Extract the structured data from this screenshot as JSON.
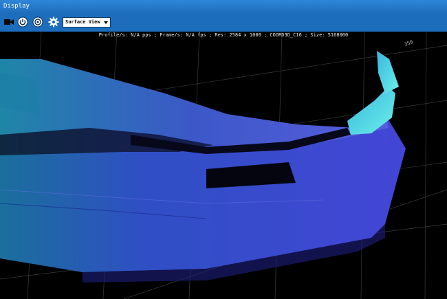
{
  "window": {
    "title": "Display"
  },
  "toolbar": {
    "view_mode": {
      "selected": "Surface View"
    },
    "buttons": [
      {
        "icon": "camera-icon"
      },
      {
        "icon": "power-icon"
      },
      {
        "icon": "record-icon"
      },
      {
        "icon": "settings-gear-icon"
      }
    ]
  },
  "viewport": {
    "status": "Profile/s: N/A pps ; Frame/s: N/A fps ; Res: 2584 x 1000 ; COORD3D_C16 ; Size: 5168000",
    "axis_tick": "350"
  },
  "colors": {
    "titlebar": "#2f86d8",
    "toolbar": "#1d6dbd",
    "background": "#000000",
    "scan_blue": "#3a3fd0",
    "scan_cyan": "#4fd6e0"
  }
}
